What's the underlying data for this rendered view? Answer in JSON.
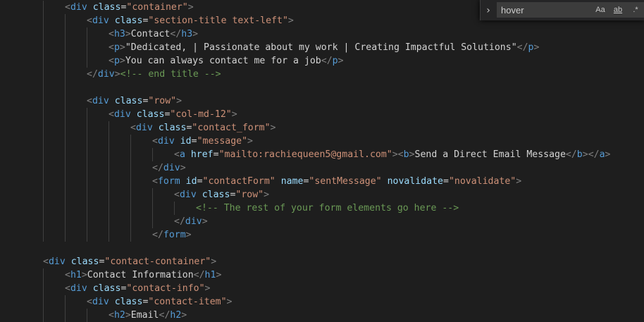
{
  "code_lines": [
    {
      "indent": 2,
      "tokens": [
        [
          "p",
          "<"
        ],
        [
          "tag",
          "div"
        ],
        [
          "txt",
          " "
        ],
        [
          "attr",
          "class"
        ],
        [
          "txt",
          "="
        ],
        [
          "str",
          "\"container\""
        ],
        [
          "p",
          ">"
        ]
      ]
    },
    {
      "indent": 3,
      "tokens": [
        [
          "p",
          "<"
        ],
        [
          "tag",
          "div"
        ],
        [
          "txt",
          " "
        ],
        [
          "attr",
          "class"
        ],
        [
          "txt",
          "="
        ],
        [
          "str",
          "\"section-title text-left\""
        ],
        [
          "p",
          ">"
        ]
      ]
    },
    {
      "indent": 4,
      "tokens": [
        [
          "p",
          "<"
        ],
        [
          "tag",
          "h3"
        ],
        [
          "p",
          ">"
        ],
        [
          "txt",
          "Contact"
        ],
        [
          "p",
          "</"
        ],
        [
          "tag",
          "h3"
        ],
        [
          "p",
          ">"
        ]
      ]
    },
    {
      "indent": 4,
      "tokens": [
        [
          "p",
          "<"
        ],
        [
          "tag",
          "p"
        ],
        [
          "p",
          ">"
        ],
        [
          "txt",
          "\"Dedicated, | Passionate about my work | Creating Impactful Solutions\""
        ],
        [
          "p",
          "</"
        ],
        [
          "tag",
          "p"
        ],
        [
          "p",
          ">"
        ]
      ]
    },
    {
      "indent": 4,
      "tokens": [
        [
          "p",
          "<"
        ],
        [
          "tag",
          "p"
        ],
        [
          "p",
          ">"
        ],
        [
          "txt",
          "You can always contact me for a job"
        ],
        [
          "p",
          "</"
        ],
        [
          "tag",
          "p"
        ],
        [
          "p",
          ">"
        ]
      ]
    },
    {
      "indent": 3,
      "tokens": [
        [
          "p",
          "</"
        ],
        [
          "tag",
          "div"
        ],
        [
          "p",
          ">"
        ],
        [
          "cmt",
          "<!-- end title -->"
        ]
      ]
    },
    {
      "indent": 0,
      "tokens": []
    },
    {
      "indent": 3,
      "tokens": [
        [
          "p",
          "<"
        ],
        [
          "tag",
          "div"
        ],
        [
          "txt",
          " "
        ],
        [
          "attr",
          "class"
        ],
        [
          "txt",
          "="
        ],
        [
          "str",
          "\"row\""
        ],
        [
          "p",
          ">"
        ]
      ]
    },
    {
      "indent": 4,
      "tokens": [
        [
          "p",
          "<"
        ],
        [
          "tag",
          "div"
        ],
        [
          "txt",
          " "
        ],
        [
          "attr",
          "class"
        ],
        [
          "txt",
          "="
        ],
        [
          "str",
          "\"col-md-12\""
        ],
        [
          "p",
          ">"
        ]
      ]
    },
    {
      "indent": 5,
      "tokens": [
        [
          "p",
          "<"
        ],
        [
          "tag",
          "div"
        ],
        [
          "txt",
          " "
        ],
        [
          "attr",
          "class"
        ],
        [
          "txt",
          "="
        ],
        [
          "str",
          "\"contact_form\""
        ],
        [
          "p",
          ">"
        ]
      ]
    },
    {
      "indent": 6,
      "tokens": [
        [
          "p",
          "<"
        ],
        [
          "tag",
          "div"
        ],
        [
          "txt",
          " "
        ],
        [
          "attr",
          "id"
        ],
        [
          "txt",
          "="
        ],
        [
          "str",
          "\"message\""
        ],
        [
          "p",
          ">"
        ]
      ]
    },
    {
      "indent": 7,
      "tokens": [
        [
          "p",
          "<"
        ],
        [
          "tag",
          "a"
        ],
        [
          "txt",
          " "
        ],
        [
          "attr",
          "href"
        ],
        [
          "txt",
          "="
        ],
        [
          "str",
          "\"mailto:rachiequeen5@gmail.com\""
        ],
        [
          "p",
          ">"
        ],
        [
          "p",
          "<"
        ],
        [
          "tag",
          "b"
        ],
        [
          "p",
          ">"
        ],
        [
          "txt",
          "Send a Direct Email Message"
        ],
        [
          "p",
          "</"
        ],
        [
          "tag",
          "b"
        ],
        [
          "p",
          ">"
        ],
        [
          "p",
          "</"
        ],
        [
          "tag",
          "a"
        ],
        [
          "p",
          ">"
        ]
      ]
    },
    {
      "indent": 6,
      "tokens": [
        [
          "p",
          "</"
        ],
        [
          "tag",
          "div"
        ],
        [
          "p",
          ">"
        ]
      ]
    },
    {
      "indent": 6,
      "tokens": [
        [
          "p",
          "<"
        ],
        [
          "tag",
          "form"
        ],
        [
          "txt",
          " "
        ],
        [
          "attr",
          "id"
        ],
        [
          "txt",
          "="
        ],
        [
          "str",
          "\"contactForm\""
        ],
        [
          "txt",
          " "
        ],
        [
          "attr",
          "name"
        ],
        [
          "txt",
          "="
        ],
        [
          "str",
          "\"sentMessage\""
        ],
        [
          "txt",
          " "
        ],
        [
          "attr",
          "novalidate"
        ],
        [
          "txt",
          "="
        ],
        [
          "str",
          "\"novalidate\""
        ],
        [
          "p",
          ">"
        ]
      ]
    },
    {
      "indent": 7,
      "tokens": [
        [
          "p",
          "<"
        ],
        [
          "tag",
          "div"
        ],
        [
          "txt",
          " "
        ],
        [
          "attr",
          "class"
        ],
        [
          "txt",
          "="
        ],
        [
          "str",
          "\"row\""
        ],
        [
          "p",
          ">"
        ]
      ]
    },
    {
      "indent": 8,
      "tokens": [
        [
          "cmt",
          "<!-- The rest of your form elements go here -->"
        ]
      ]
    },
    {
      "indent": 7,
      "tokens": [
        [
          "p",
          "</"
        ],
        [
          "tag",
          "div"
        ],
        [
          "p",
          ">"
        ]
      ]
    },
    {
      "indent": 6,
      "tokens": [
        [
          "p",
          "</"
        ],
        [
          "tag",
          "form"
        ],
        [
          "p",
          ">"
        ]
      ]
    },
    {
      "indent": 0,
      "tokens": []
    },
    {
      "indent": 1,
      "tokens": [
        [
          "p",
          "<"
        ],
        [
          "tag",
          "div"
        ],
        [
          "txt",
          " "
        ],
        [
          "attr",
          "class"
        ],
        [
          "txt",
          "="
        ],
        [
          "str",
          "\"contact-container\""
        ],
        [
          "p",
          ">"
        ]
      ]
    },
    {
      "indent": 2,
      "tokens": [
        [
          "p",
          "<"
        ],
        [
          "tag",
          "h1"
        ],
        [
          "p",
          ">"
        ],
        [
          "txt",
          "Contact Information"
        ],
        [
          "p",
          "</"
        ],
        [
          "tag",
          "h1"
        ],
        [
          "p",
          ">"
        ]
      ]
    },
    {
      "indent": 2,
      "tokens": [
        [
          "p",
          "<"
        ],
        [
          "tag",
          "div"
        ],
        [
          "txt",
          " "
        ],
        [
          "attr",
          "class"
        ],
        [
          "txt",
          "="
        ],
        [
          "str",
          "\"contact-info\""
        ],
        [
          "p",
          ">"
        ]
      ]
    },
    {
      "indent": 3,
      "tokens": [
        [
          "p",
          "<"
        ],
        [
          "tag",
          "div"
        ],
        [
          "txt",
          " "
        ],
        [
          "attr",
          "class"
        ],
        [
          "txt",
          "="
        ],
        [
          "str",
          "\"contact-item\""
        ],
        [
          "p",
          ">"
        ]
      ]
    },
    {
      "indent": 4,
      "tokens": [
        [
          "p",
          "<"
        ],
        [
          "tag",
          "h2"
        ],
        [
          "p",
          ">"
        ],
        [
          "txt",
          "Email"
        ],
        [
          "p",
          "</"
        ],
        [
          "tag",
          "h2"
        ],
        [
          "p",
          ">"
        ]
      ]
    }
  ],
  "find_widget": {
    "search_value": "hover",
    "toggle_icon": "chevron-right-icon",
    "toggle_glyph": "›",
    "match_case_label": "Aa",
    "whole_word_label": "ab",
    "regex_label": ".*"
  },
  "colors": {
    "background": "#1e1e1e",
    "tag": "#569cd6",
    "attribute": "#9cdcfe",
    "string": "#ce9178",
    "comment": "#6a9955",
    "punctuation": "#808080",
    "text": "#d4d4d4"
  }
}
